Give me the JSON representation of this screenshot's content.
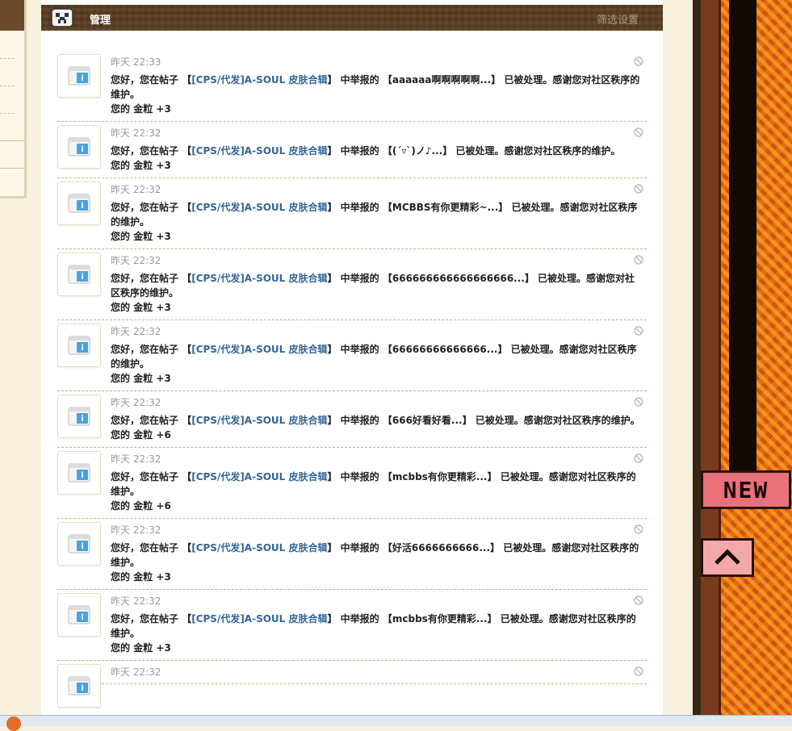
{
  "header": {
    "title": "管理",
    "filter_link": "筛选设置"
  },
  "notice": {
    "greeting": "您好，您在帖子",
    "post_title": "[CPS/代发]A-SOUL 皮肤合辑",
    "mid": "中举报的",
    "suffix": "已被处理。感谢您对社区秩序的维护。",
    "reward_prefix": "您的",
    "reward_unit": "金粒"
  },
  "notifications": [
    {
      "time": "昨天 22:33",
      "report": "【aaaaaa啊啊啊啊啊...】",
      "reward": "+3"
    },
    {
      "time": "昨天 22:32",
      "report": "【(´▿`)ノ♪...】",
      "reward": "+3"
    },
    {
      "time": "昨天 22:32",
      "report": "【MCBBS有你更精彩~...】",
      "reward": "+3"
    },
    {
      "time": "昨天 22:32",
      "report": "【666666666666666666...】",
      "reward": "+3"
    },
    {
      "time": "昨天 22:32",
      "report": "【66666666666666...】",
      "reward": "+3"
    },
    {
      "time": "昨天 22:32",
      "report": "【666好看好看...】",
      "reward": "+6"
    },
    {
      "time": "昨天 22:32",
      "report": "【mcbbs有你更精彩...】",
      "reward": "+6"
    },
    {
      "time": "昨天 22:32",
      "report": "【好活6666666666...】",
      "reward": "+3"
    },
    {
      "time": "昨天 22:32",
      "report": "【mcbbs有你更精彩...】",
      "reward": "+3"
    },
    {
      "time": "昨天 22:32",
      "report": "",
      "reward": ""
    }
  ],
  "side_buttons": {
    "new_label": "NEW"
  },
  "colors": {
    "link": "#336699",
    "header_bg": "#5a3d20",
    "separator": "#d9a68a"
  }
}
